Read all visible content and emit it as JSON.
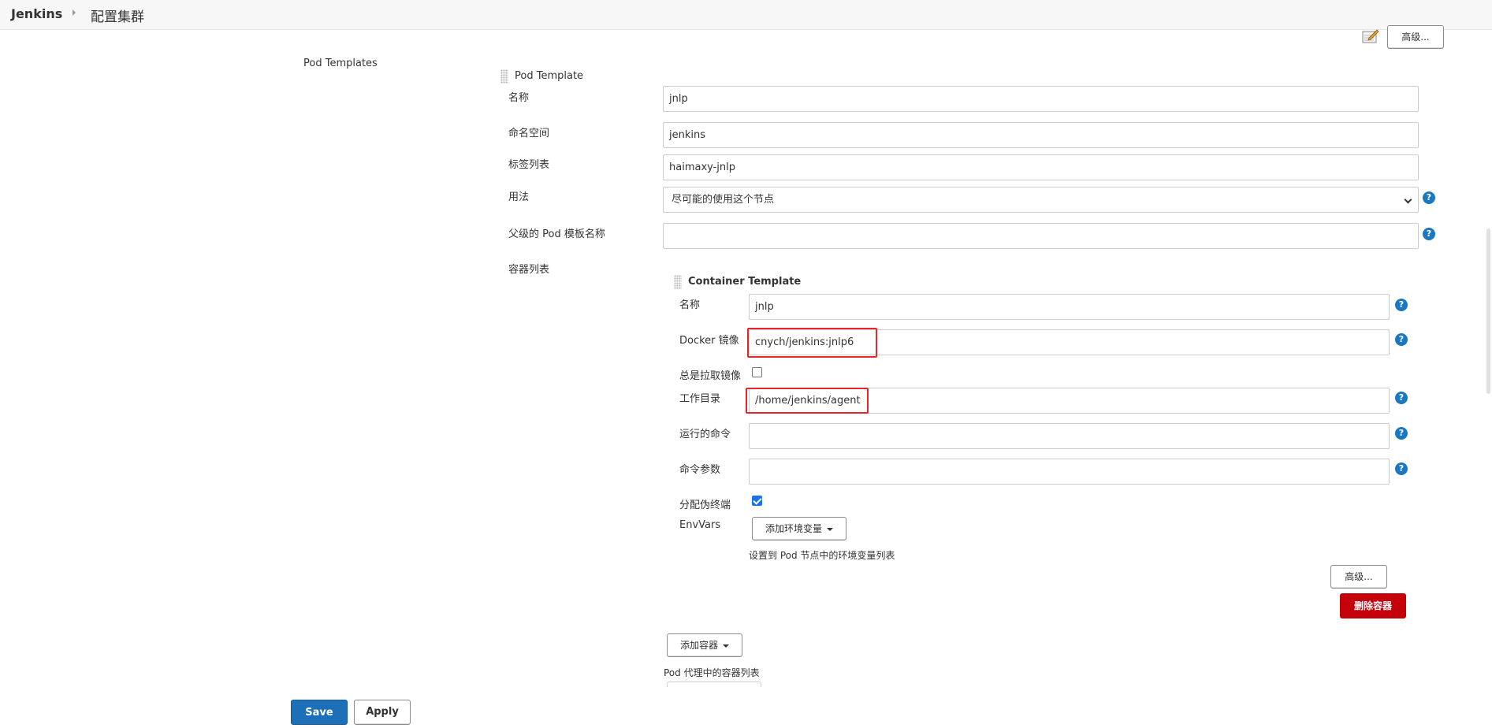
{
  "breadcrumb": {
    "root": "Jenkins",
    "page": "配置集群"
  },
  "top_advanced_button": "高级...",
  "pod_templates": {
    "section_label": "Pod Templates",
    "pod_template_heading": "Pod Template",
    "fields": {
      "name": {
        "label": "名称",
        "value": "jnlp"
      },
      "namespace": {
        "label": "命名空间",
        "value": "jenkins"
      },
      "labels": {
        "label": "标签列表",
        "value": "haimaxy-jnlp"
      },
      "usage": {
        "label": "用法",
        "value": "尽可能的使用这个节点"
      },
      "parent": {
        "label": "父级的 Pod 模板名称",
        "value": ""
      },
      "containers": {
        "label": "容器列表"
      }
    }
  },
  "container_template": {
    "heading": "Container Template",
    "name": {
      "label": "名称",
      "value": "jnlp"
    },
    "docker_image": {
      "label": "Docker 镜像",
      "value": "cnych/jenkins:jnlp6"
    },
    "always_pull": {
      "label": "总是拉取镜像",
      "checked": false
    },
    "working_dir": {
      "label": "工作目录",
      "value": "/home/jenkins/agent"
    },
    "command": {
      "label": "运行的命令",
      "value": ""
    },
    "args": {
      "label": "命令参数",
      "value": ""
    },
    "tty": {
      "label": "分配伪终端",
      "checked": true
    },
    "envvars": {
      "label": "EnvVars",
      "add_button": "添加环境变量",
      "description": "设置到 Pod 节点中的环境变量列表"
    },
    "advanced_button": "高级...",
    "delete_button": "删除容器"
  },
  "add_container_button": "添加容器",
  "containers_description": "Pod 代理中的容器列表",
  "footer": {
    "save": "Save",
    "apply": "Apply"
  },
  "help_glyph": "?",
  "colors": {
    "primary": "#1d6fb8",
    "danger": "#c4000a",
    "help": "#1a78c2",
    "highlight": "#e8252a"
  }
}
